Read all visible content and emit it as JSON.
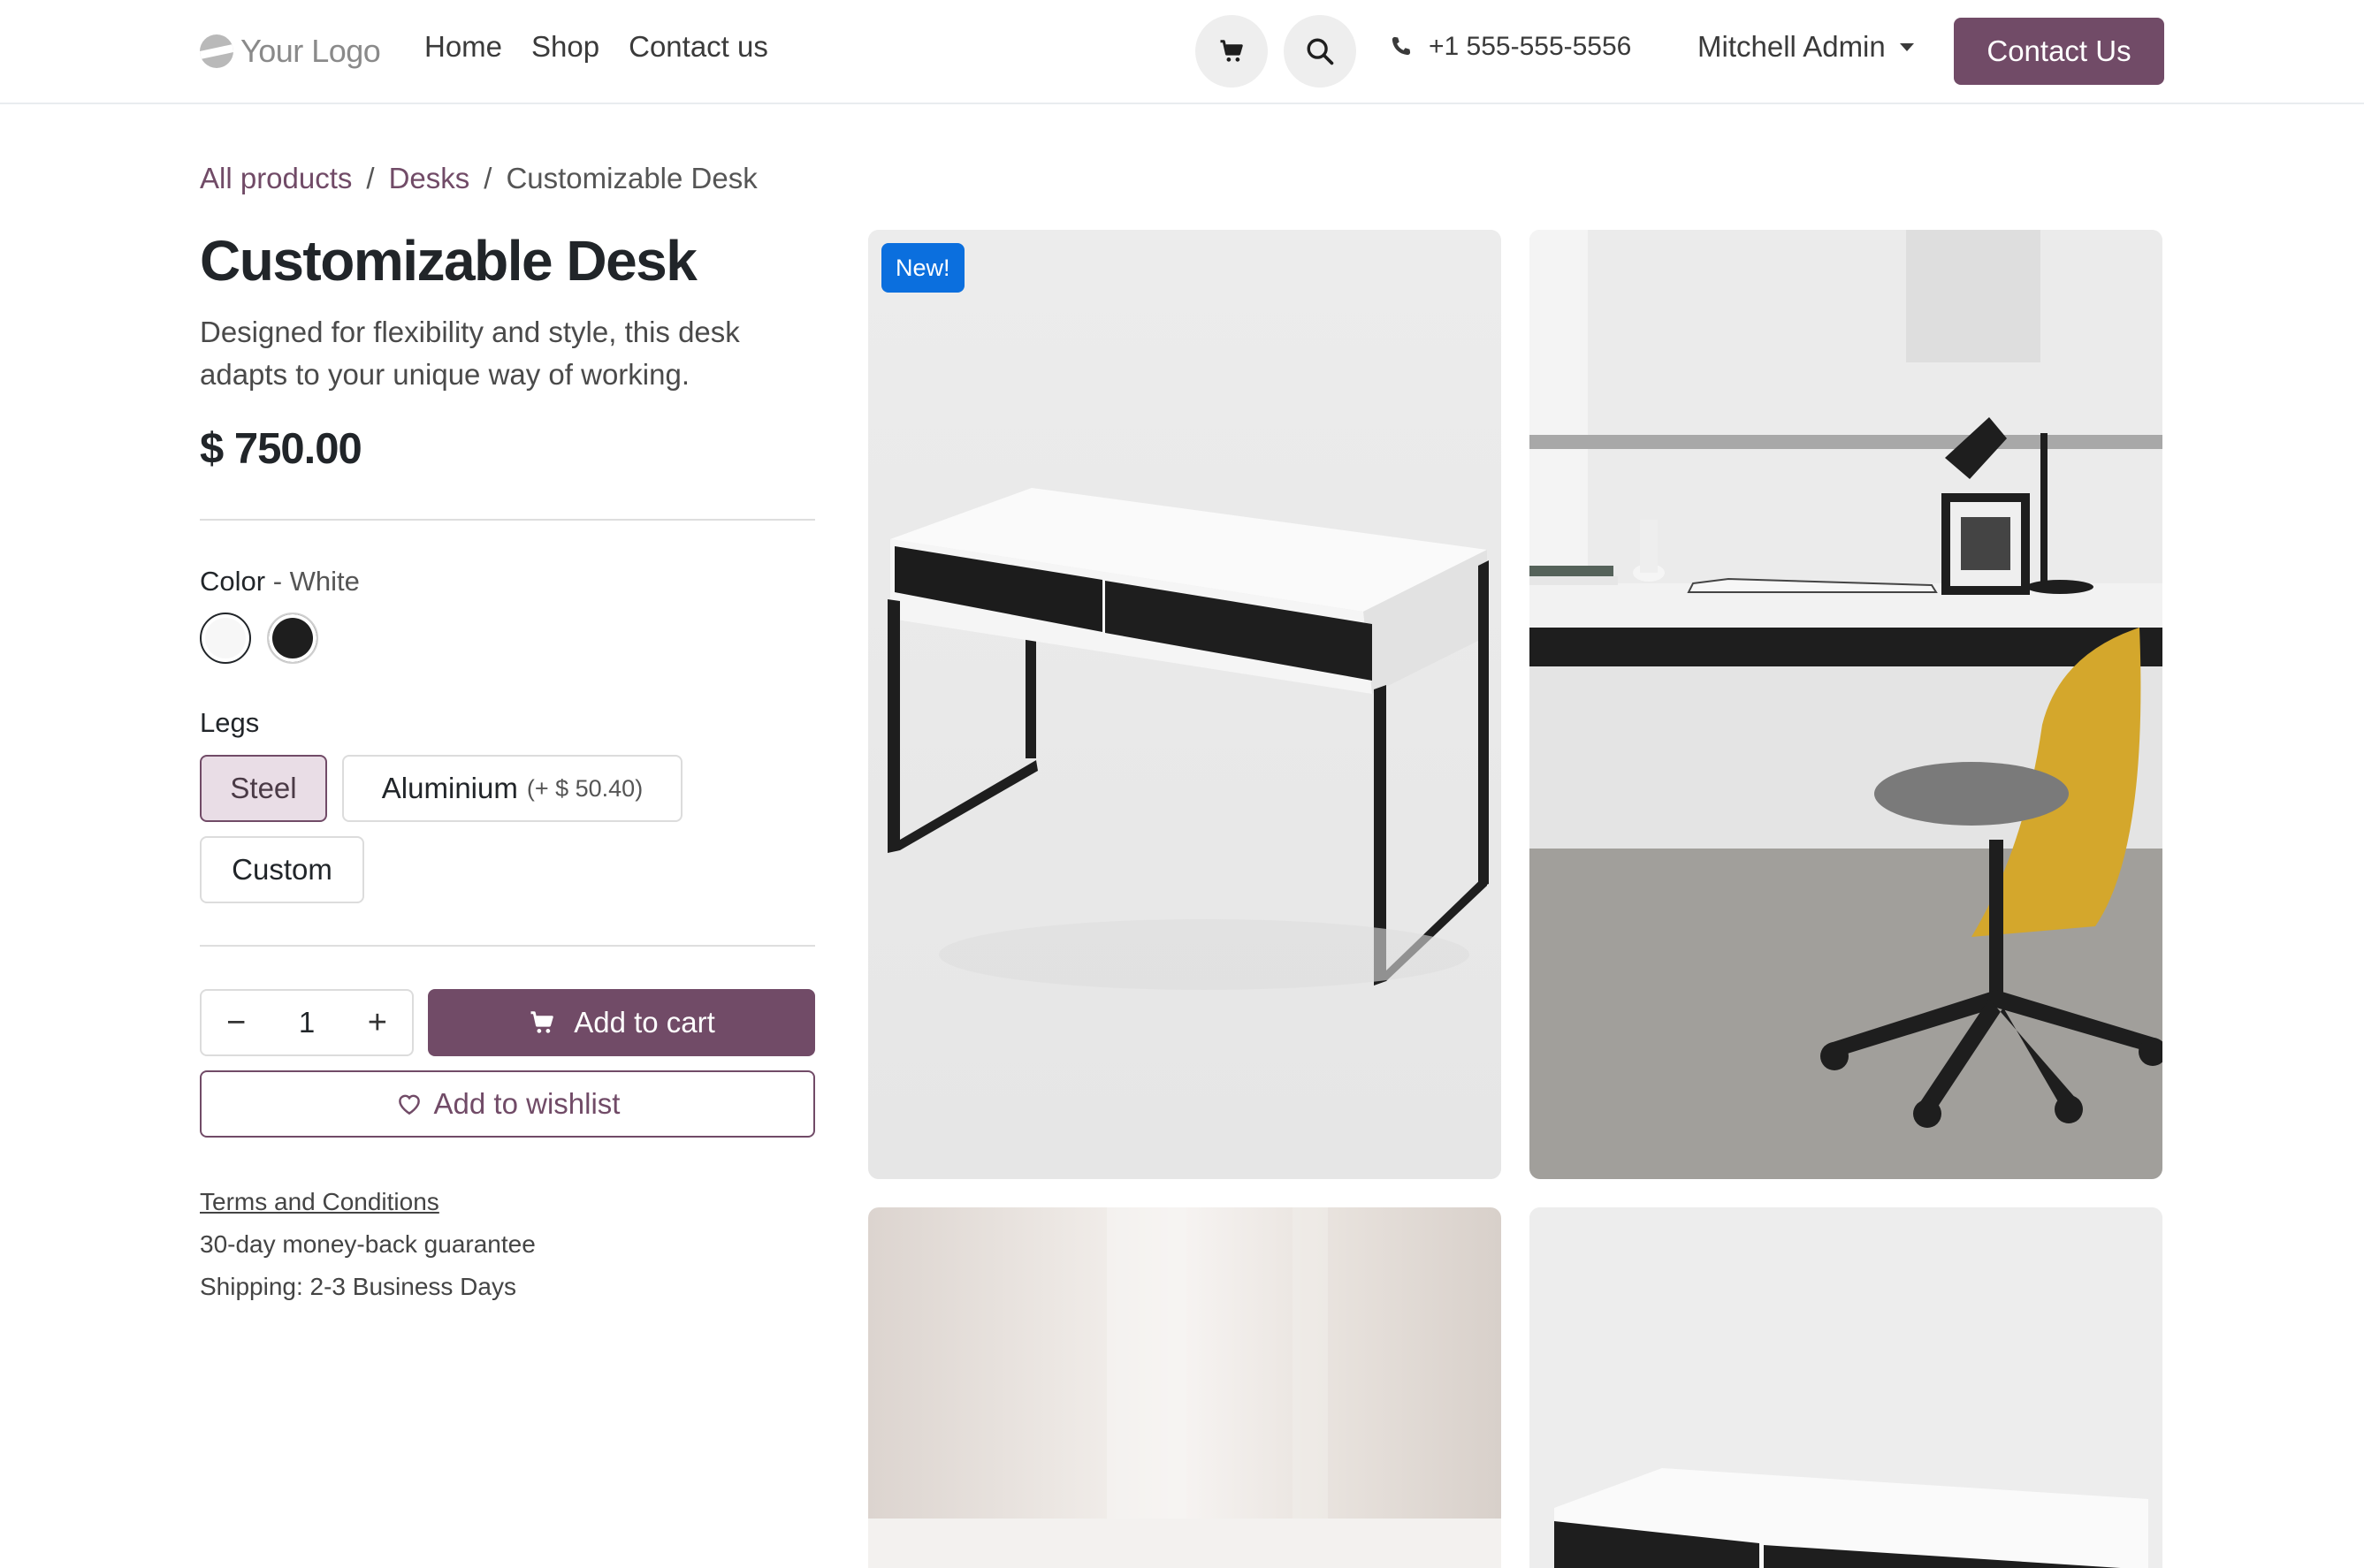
{
  "header": {
    "logo_text": "Your Logo",
    "nav": [
      "Home",
      "Shop",
      "Contact us"
    ],
    "phone": "+1 555-555-5556",
    "user": "Mitchell Admin",
    "contact_button": "Contact Us",
    "icons": [
      "cart-icon",
      "search-icon",
      "phone-icon",
      "chevron-down-icon"
    ]
  },
  "breadcrumb": {
    "items": [
      "All products",
      "Desks",
      "Customizable Desk"
    ],
    "separator": "/"
  },
  "product": {
    "title": "Customizable Desk",
    "description": "Designed for flexibility and style, this desk adapts to your unique way of working.",
    "price": "$ 750.00",
    "badge": "New!"
  },
  "color": {
    "label": "Color",
    "separator": " - ",
    "selected": "White",
    "options": [
      {
        "name": "White",
        "hex": "#f7f7f7"
      },
      {
        "name": "Black",
        "hex": "#1e1e1e"
      }
    ]
  },
  "legs": {
    "label": "Legs",
    "options": [
      {
        "label": "Steel",
        "extra": "",
        "selected": true
      },
      {
        "label": "Aluminium",
        "extra": "(+ $ 50.40)",
        "selected": false
      },
      {
        "label": "Custom",
        "extra": "",
        "selected": false
      }
    ]
  },
  "purchase": {
    "quantity": "1",
    "minus": "−",
    "plus": "+",
    "add_to_cart": "Add to cart",
    "add_to_wishlist": "Add to wishlist"
  },
  "info": {
    "terms": "Terms and Conditions",
    "guarantee": "30-day money-back guarantee",
    "shipping": "Shipping: 2-3 Business Days"
  },
  "colors": {
    "brand": "#714b67",
    "badge": "#0b6fde"
  }
}
